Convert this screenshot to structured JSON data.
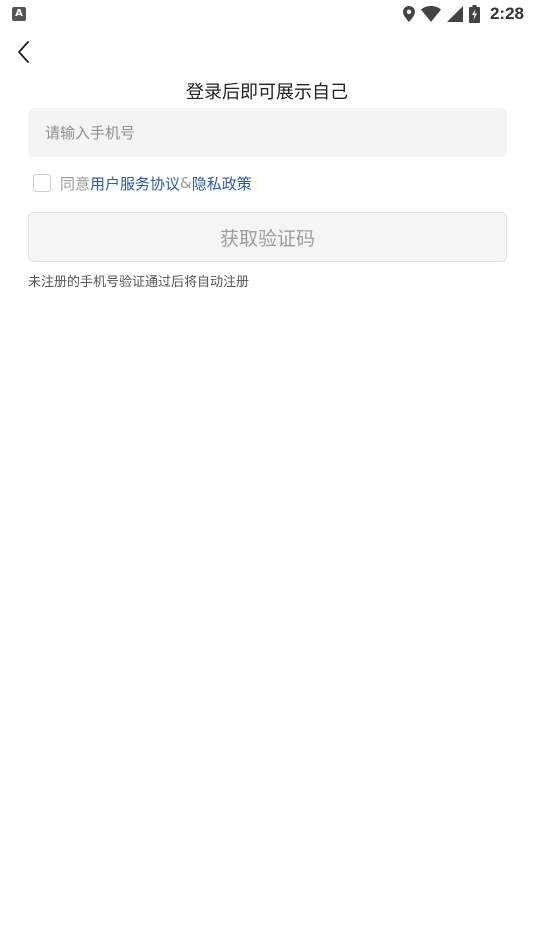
{
  "status_bar": {
    "left_badge": "A",
    "time": "2:28",
    "icons": [
      "location-icon",
      "wifi-icon",
      "signal-icon",
      "battery-charging-icon"
    ]
  },
  "header": {
    "back_icon": "chevron-left-icon",
    "title": "登录后即可展示自己"
  },
  "form": {
    "phone_placeholder": "请输入手机号",
    "phone_value": "",
    "agree_prefix": "同意",
    "agree_terms_link": "用户服务协议",
    "agree_amp": "&",
    "agree_privacy_link": "隐私政策",
    "agree_checked": false,
    "get_code_label": "获取验证码",
    "hint": "未注册的手机号验证通过后将自动注册"
  },
  "colors": {
    "link": "#2d5aa6",
    "field_bg": "#f4f4f4",
    "button_bg": "#f5f5f5",
    "button_text": "#9d9d9d"
  }
}
